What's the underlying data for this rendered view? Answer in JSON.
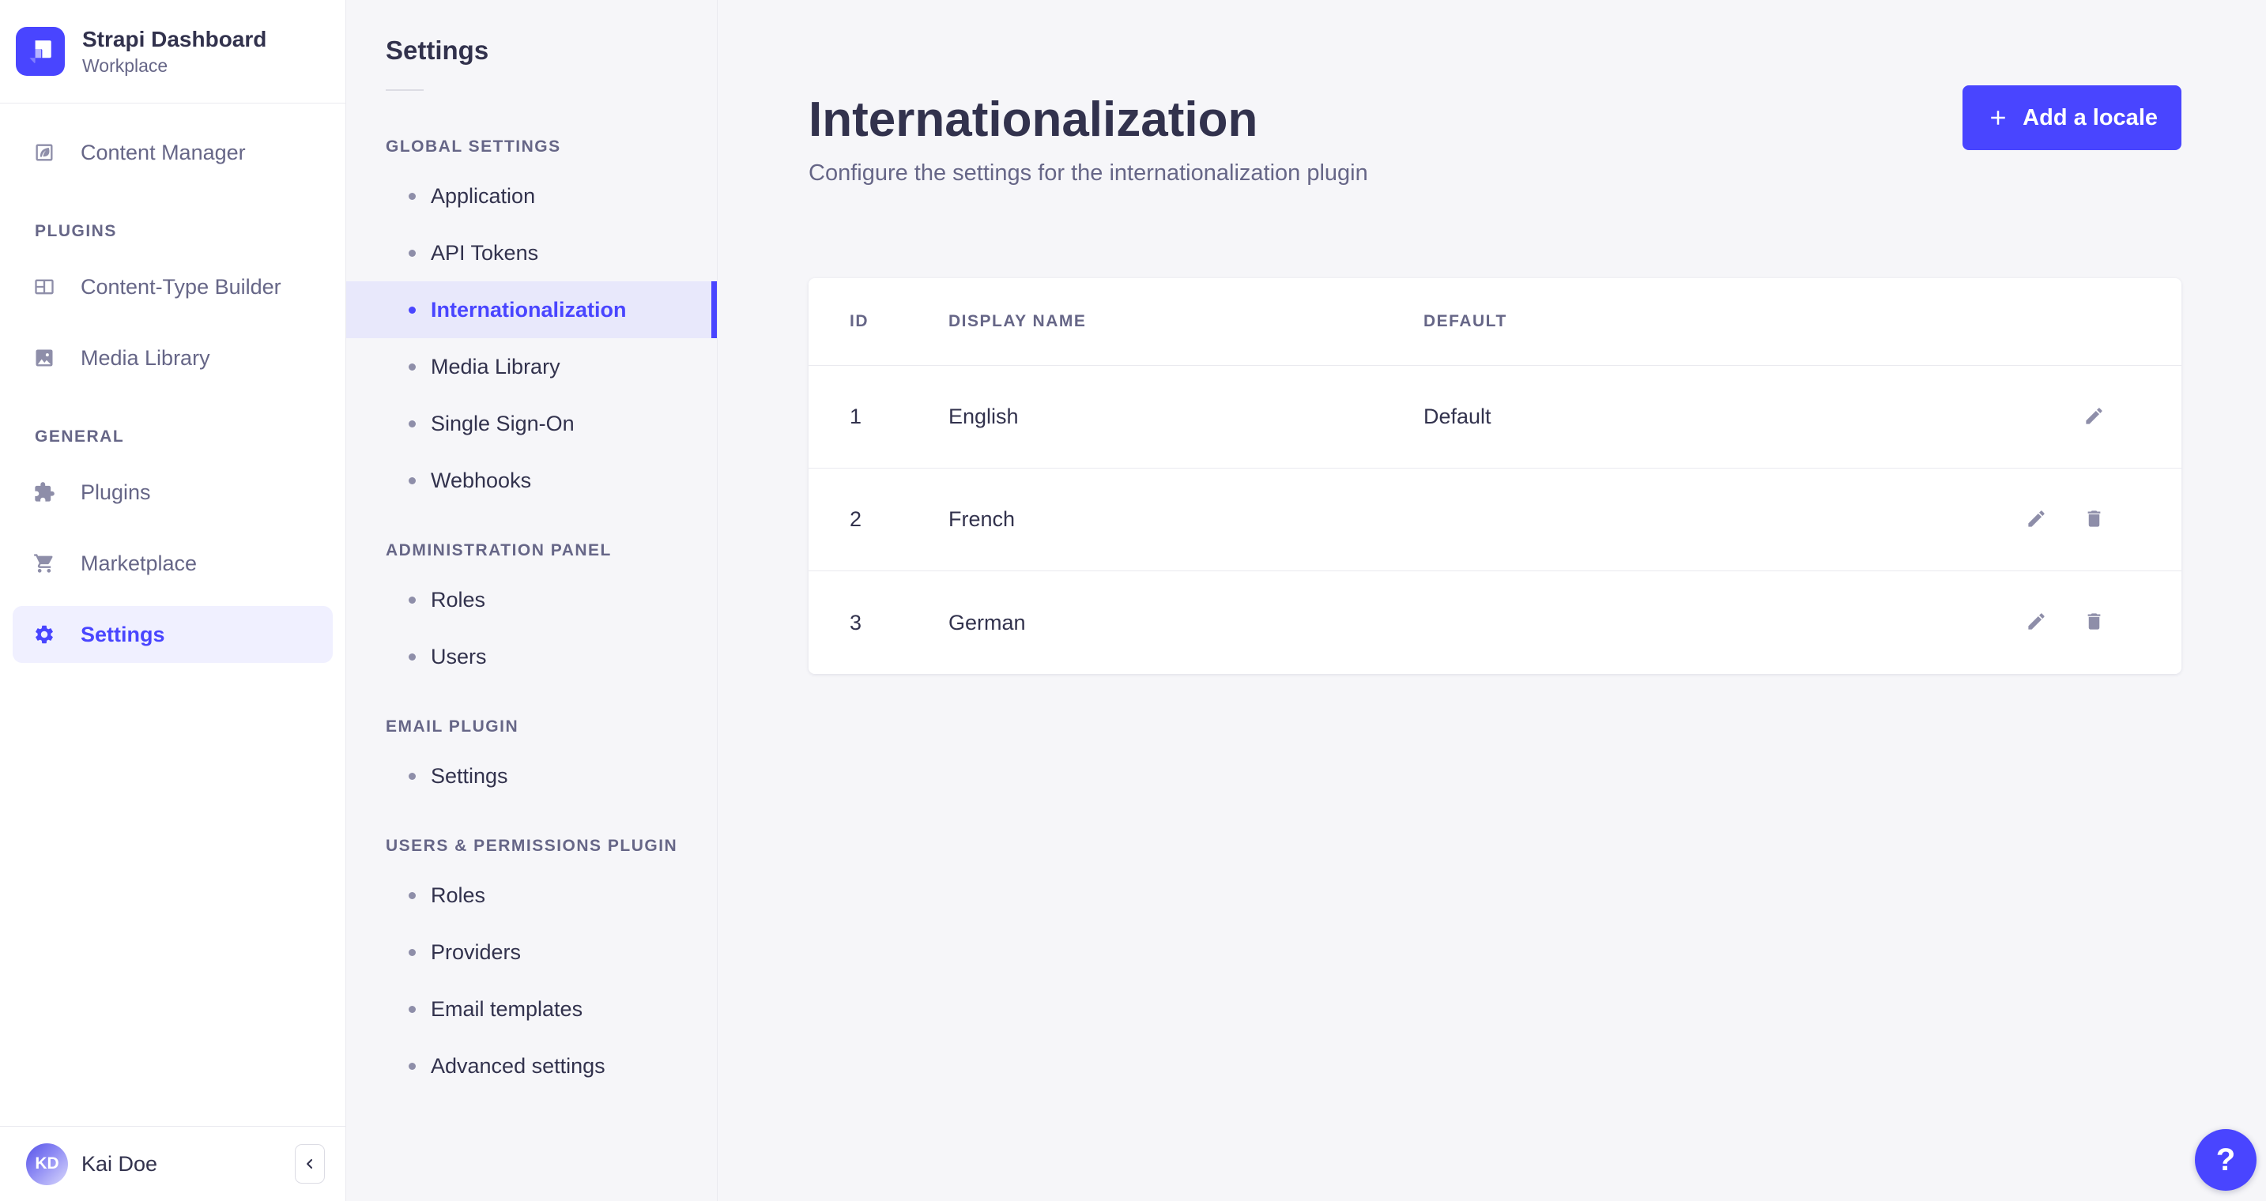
{
  "colors": {
    "primary": "#4945ff",
    "primary_light": "#f0f0ff",
    "subnav_selected_bg": "#e8e8fb",
    "text_dark": "#32324d",
    "text_muted": "#666687",
    "icon_muted": "#8e8ea9",
    "border": "#eaeaef",
    "page_bg": "#f6f6f9",
    "card_bg": "#ffffff"
  },
  "brand": {
    "name": "Strapi Dashboard",
    "workplace": "Workplace"
  },
  "mainNav": {
    "sections": [
      {
        "label": "",
        "items": [
          {
            "label": "Content Manager",
            "icon": "content-manager-icon",
            "selected": false
          }
        ]
      },
      {
        "label": "PLUGINS",
        "items": [
          {
            "label": "Content-Type Builder",
            "icon": "content-type-builder-icon",
            "selected": false
          },
          {
            "label": "Media Library",
            "icon": "media-library-icon",
            "selected": false
          }
        ]
      },
      {
        "label": "GENERAL",
        "items": [
          {
            "label": "Plugins",
            "icon": "plugins-icon",
            "selected": false
          },
          {
            "label": "Marketplace",
            "icon": "marketplace-icon",
            "selected": false
          },
          {
            "label": "Settings",
            "icon": "settings-icon",
            "selected": true
          }
        ]
      }
    ],
    "user": {
      "initials": "KD",
      "name": "Kai Doe"
    }
  },
  "settingsNav": {
    "title": "Settings",
    "sections": [
      {
        "label": "GLOBAL SETTINGS",
        "selected": "Internationalization",
        "items": [
          "Application",
          "API Tokens",
          "Internationalization",
          "Media Library",
          "Single Sign-On",
          "Webhooks"
        ]
      },
      {
        "label": "ADMINISTRATION PANEL",
        "selected": "",
        "items": [
          "Roles",
          "Users"
        ]
      },
      {
        "label": "EMAIL PLUGIN",
        "selected": "",
        "items": [
          "Settings"
        ]
      },
      {
        "label": "USERS & PERMISSIONS PLUGIN",
        "selected": "",
        "items": [
          "Roles",
          "Providers",
          "Email templates",
          "Advanced settings"
        ]
      }
    ]
  },
  "page": {
    "title": "Internationalization",
    "subtitle": "Configure the settings for the internationalization plugin",
    "add_button": "Add a locale"
  },
  "table": {
    "headers": [
      "ID",
      "DISPLAY NAME",
      "DEFAULT"
    ],
    "rows": [
      {
        "id": "1",
        "display_name": "English",
        "default": "Default",
        "actions": [
          "edit"
        ]
      },
      {
        "id": "2",
        "display_name": "French",
        "default": "",
        "actions": [
          "edit",
          "delete"
        ]
      },
      {
        "id": "3",
        "display_name": "German",
        "default": "",
        "actions": [
          "edit",
          "delete"
        ]
      }
    ]
  },
  "help": {
    "label": "?"
  }
}
